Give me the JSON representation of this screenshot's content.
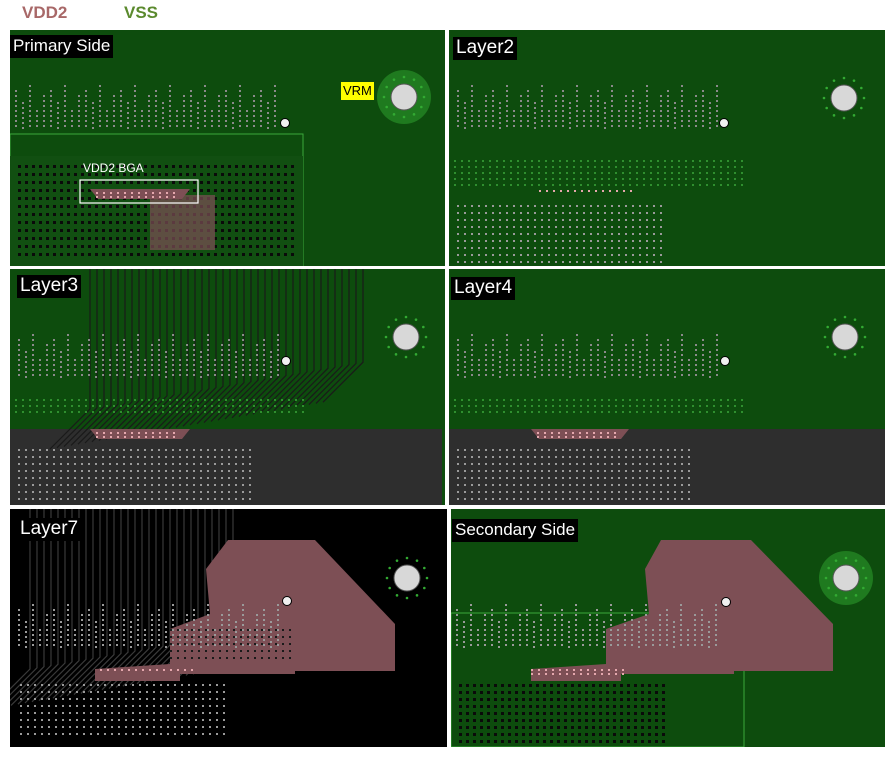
{
  "legend": {
    "vdd2": {
      "label": "VDD2",
      "color": "#a86868"
    },
    "vss": {
      "label": "VSS",
      "color": "#5b8a2e"
    }
  },
  "colors": {
    "plane_green": "#0d4c0d",
    "plane_gray": "#2e2e2e",
    "plane_black": "#000000",
    "vdd2_copper": "#7d4f55",
    "via_vdd2": "#e4a7ad",
    "via_vss": "#2f8f2f",
    "trace": "#1a1a1a"
  },
  "panels": [
    {
      "id": "primary",
      "label": "Primary Side",
      "vrm_label": "VRM",
      "bga_label": "VDD2 BGA"
    },
    {
      "id": "layer2",
      "label": "Layer2"
    },
    {
      "id": "layer3",
      "label": "Layer3"
    },
    {
      "id": "layer4",
      "label": "Layer4"
    },
    {
      "id": "layer7",
      "label": "Layer7"
    },
    {
      "id": "secondary",
      "label": "Secondary Side"
    }
  ]
}
